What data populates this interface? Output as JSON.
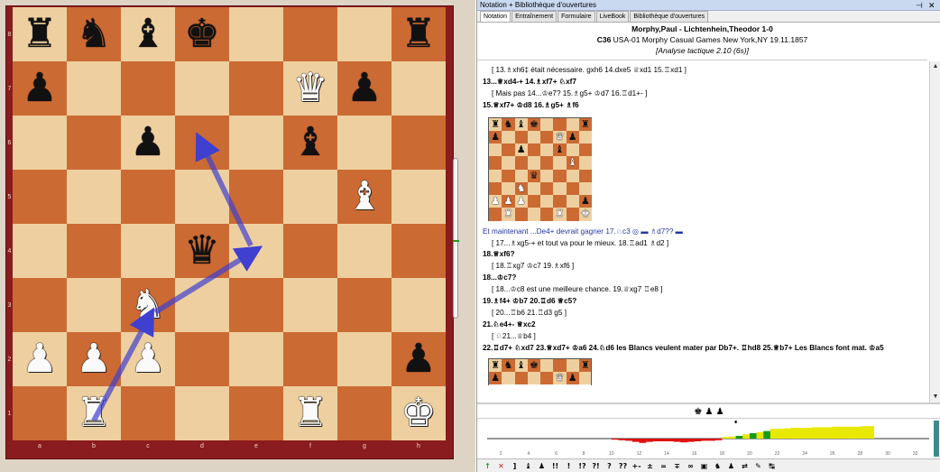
{
  "window": {
    "title": "Notation + Bibliothèque d'ouvertures",
    "pin_glyph": "⊣",
    "close_glyph": "✕"
  },
  "tabs": [
    {
      "label": "Notation",
      "active": true
    },
    {
      "label": "Entraînement",
      "active": false
    },
    {
      "label": "Formulaire",
      "active": false
    },
    {
      "label": "LiveBook",
      "active": false
    },
    {
      "label": "Bibliothèque d'ouvertures",
      "active": false
    }
  ],
  "game_header": {
    "players": "Morphy,Paul - Lichtenhein,Theodor  1-0",
    "eco": "C36",
    "event": "USA-01 Morphy Casual Games New York,NY  19.11.1857",
    "analysis": "[Analyse tactique 2.10 (6s)]"
  },
  "board": {
    "files": [
      "a",
      "b",
      "c",
      "d",
      "e",
      "f",
      "g",
      "h"
    ],
    "ranks": [
      "8",
      "7",
      "6",
      "5",
      "4",
      "3",
      "2",
      "1"
    ],
    "position": [
      [
        "r",
        "n",
        "b",
        "k",
        "",
        "",
        "",
        "r"
      ],
      [
        "p",
        "",
        "",
        "",
        "",
        "Q",
        "p",
        ""
      ],
      [
        "",
        "",
        "p",
        "",
        "",
        "b",
        "",
        ""
      ],
      [
        "",
        "",
        "",
        "",
        "",
        "",
        "B",
        ""
      ],
      [
        "",
        "",
        "",
        "q",
        "",
        "",
        "",
        ""
      ],
      [
        "",
        "",
        "N",
        "",
        "",
        "",
        "",
        ""
      ],
      [
        "P",
        "P",
        "P",
        "",
        "",
        "",
        "",
        "p"
      ],
      [
        "",
        "R",
        "",
        "",
        "",
        "R",
        "",
        "K"
      ]
    ],
    "light_color": "#eed0a0",
    "dark_color": "#cc6a33",
    "arrow_color": "#3f3fd0"
  },
  "notation": {
    "lines": [
      {
        "type": "var",
        "text": "[ 13.♗xh6‡ était nécessaire.  gxh6  14.dxe5  ♕xd1  15.♖xd1 ]"
      },
      {
        "type": "main",
        "text": "13...♕xd4-+  14.♗xf7+  ♘xf7"
      },
      {
        "type": "var",
        "text": "[ Mais pas  14...♔e7?  15.♗g5+  ♔d7  16.♖d1+- ]"
      },
      {
        "type": "main",
        "text": "15.♕xf7+  ♔d8  16.♗g5+  ♗f6"
      }
    ],
    "lines_after": [
      {
        "type": "cmt",
        "text": "Et maintenant ...De4+ devrait gagner  17.♘c3  ◎  ▬  ♗d7??  ▬"
      },
      {
        "type": "var",
        "text": "[ 17...♗xg5-+ et tout va pour le mieux.  18.♖ad1  ♗d2 ]"
      },
      {
        "type": "main",
        "text": "18.♕xf6?"
      },
      {
        "type": "var",
        "text": "[ 18.♖xg7  ♔c7  19.♗xf6 ]"
      },
      {
        "type": "main",
        "text": "18...♔c7?"
      },
      {
        "type": "var",
        "text": "[ 18...♔c8 est une meilleure chance.  19.♕xg7  ♖e8 ]"
      },
      {
        "type": "main",
        "text": "19.♗f4+  ♔b7  20.♖d6  ♕c5?"
      },
      {
        "type": "var",
        "text": "[ 20...♖b6  21.♖d3  g5 ]"
      },
      {
        "type": "main",
        "text": "21.♘e4+-  ♕xc2"
      },
      {
        "type": "var",
        "text": "[ ♘21...♕b4 ]"
      },
      {
        "type": "main",
        "text": "22.♖d7+  ♘xd7  23.♕xd7+  ♔a6  24.♘d6 les Blancs veulent mater par Db7+.  ♖hd8  25.♕b7+ Les Blancs font mat.  ♔a5"
      }
    ]
  },
  "material_bar": "♚ ♟ ♟",
  "eval_graph": {
    "x_ticks": [
      "2",
      "4",
      "6",
      "8",
      "10",
      "12",
      "14",
      "16",
      "18",
      "20",
      "22",
      "24",
      "26",
      "28",
      "30",
      "32"
    ],
    "values": [
      0,
      0,
      0,
      0,
      0,
      0,
      0,
      0,
      0,
      0,
      0,
      0,
      0,
      0,
      0,
      0,
      0,
      0,
      -0.2,
      -0.3,
      -0.4,
      -0.6,
      -0.8,
      -0.6,
      -0.5,
      -0.5,
      -0.5,
      -0.6,
      -0.7,
      -0.6,
      -0.5,
      -0.4,
      -0.4,
      -0.3,
      0.3,
      0.4,
      0.5,
      0.8,
      1.0,
      1.2,
      1.4,
      1.8,
      1.8,
      1.9,
      2.0,
      2.0,
      2.0,
      2.1,
      2.1,
      2.1,
      2.2,
      2.2,
      2.2,
      2.2,
      2.3,
      2.3
    ],
    "colors": {
      "positive": "#e8e800",
      "negative": "#e01010",
      "green": "#1a9b1a"
    }
  },
  "toolbar": [
    "↑",
    "✕",
    "]",
    "♝",
    "♟",
    "!!",
    "!",
    "!?",
    "?!",
    "?",
    "??",
    "+-",
    "±",
    "=",
    "∓",
    "∞",
    "▣",
    "♞",
    "♟",
    "⇄",
    "✎",
    "↹"
  ]
}
